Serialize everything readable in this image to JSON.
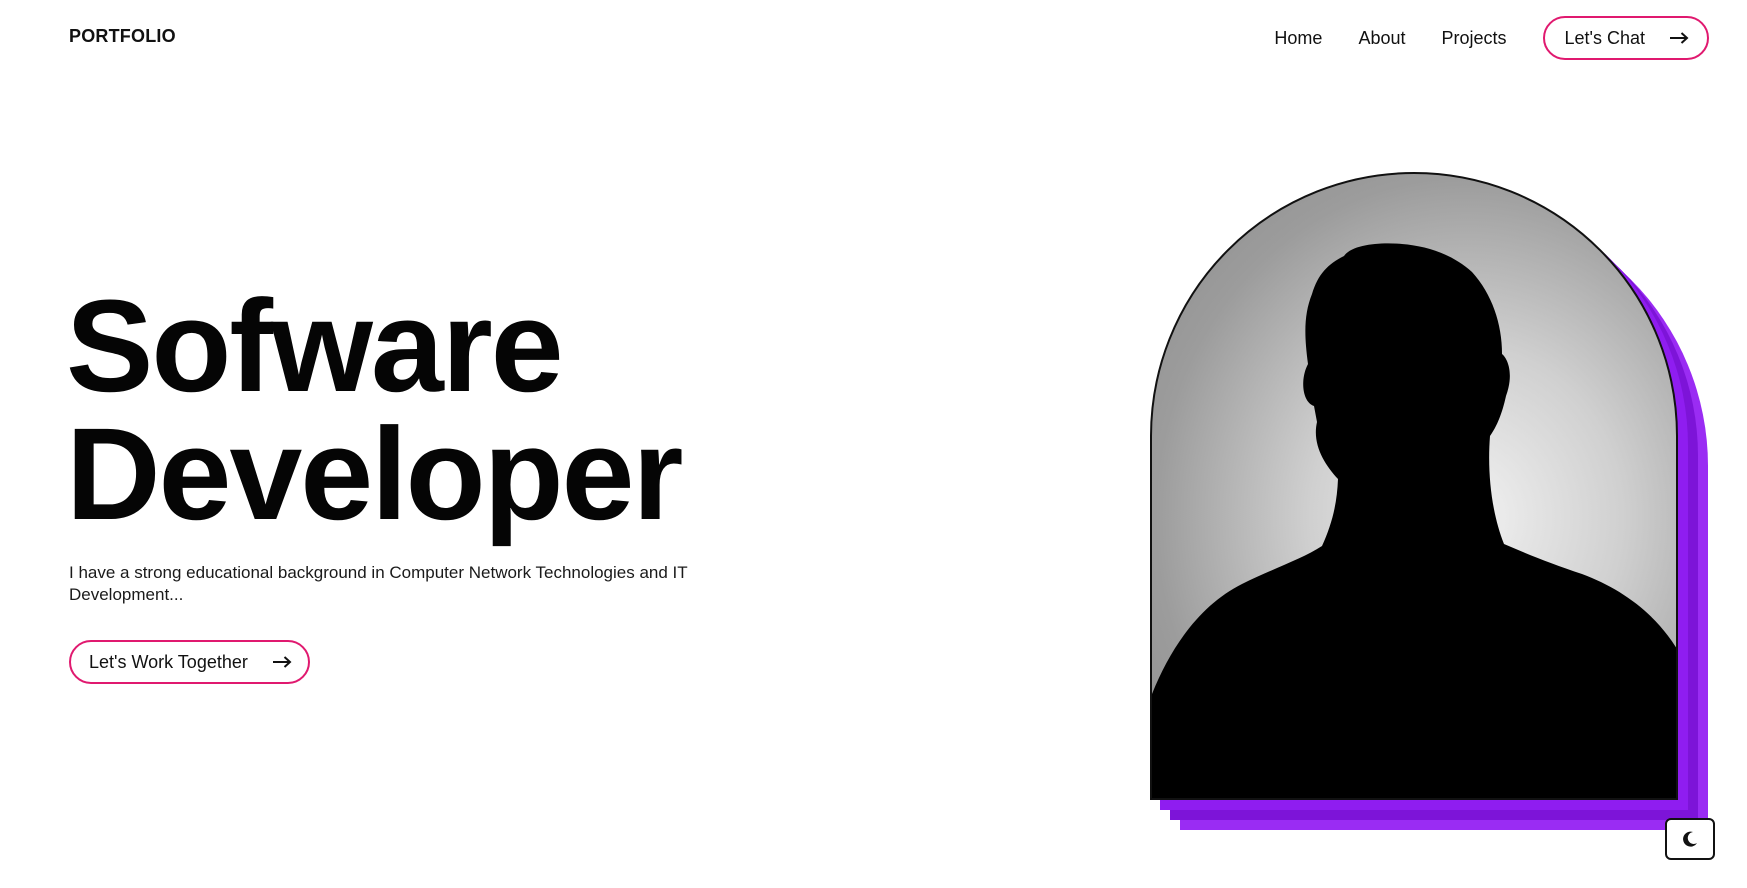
{
  "header": {
    "brand": "PORTFOLIO",
    "nav": {
      "home": "Home",
      "about": "About",
      "projects": "Projects",
      "chat_button": "Let's Chat"
    }
  },
  "hero": {
    "title_line1": "Sofware",
    "title_line2": "Developer",
    "description": "I have a strong educational background in Computer Network Technologies and IT Development...",
    "cta_button": "Let's Work Together"
  },
  "icons": {
    "arrow": "arrow-right-icon",
    "theme_toggle": "moon-icon",
    "portrait": "person-silhouette"
  },
  "colors": {
    "accent_border": "#e0196f",
    "shadow_purple": "#8f1df0",
    "text": "#111111",
    "background": "#ffffff"
  }
}
